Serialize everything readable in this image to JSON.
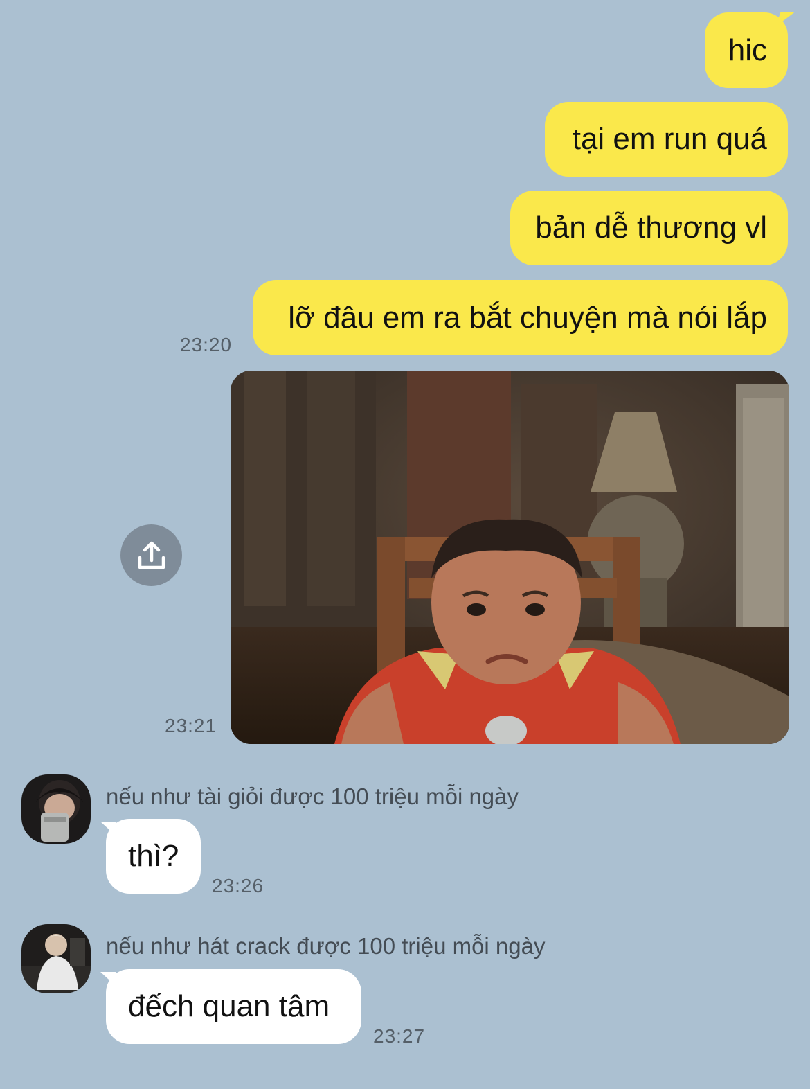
{
  "messages_out": [
    {
      "text": "hic"
    },
    {
      "text": "tại em run quá"
    },
    {
      "text": "bản dễ thương vl"
    },
    {
      "text": "lỡ đâu em ra bắt chuyện mà nói lắp"
    }
  ],
  "time_group_1": "23:20",
  "photo": {
    "time": "23:21",
    "share_icon": "share-upload-icon"
  },
  "messages_in": [
    {
      "sender": "nếu như tài giỏi được 100 triệu mỗi ngày",
      "text": "thì?",
      "time": "23:26"
    },
    {
      "sender": "nếu như hát crack được 100 triệu mỗi ngày",
      "text": "đếch quan tâm",
      "time": "23:27"
    }
  ],
  "colors": {
    "background": "#abc0d1",
    "outgoing_bubble": "#fae84b",
    "incoming_bubble": "#ffffff",
    "timestamp": "#555f68",
    "share_button": "#7f8c99"
  }
}
